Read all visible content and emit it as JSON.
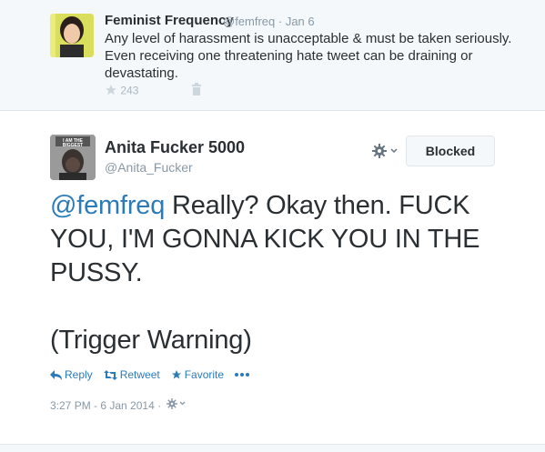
{
  "parent_tweet": {
    "name": "Feminist Frequency",
    "handle_time": "@femfreq · Jan 6",
    "text": "Any level of harassment is unacceptable & must be taken seriously. Even receiving one threatening hate tweet can be draining or devastating.",
    "favorites": "243",
    "icons": [
      "star-icon",
      "trash-icon"
    ]
  },
  "main_tweet": {
    "name": "Anita Fucker 5000",
    "handle": "@Anita_Fucker",
    "avatar_text": "I AM THE BIGGEST",
    "blocked_label": "Blocked",
    "mention": "@femfreq",
    "body": " Really? Okay then. FUCK YOU, I'M GONNA KICK YOU IN THE PUSSY.",
    "trigger": "(Trigger Warning)",
    "actions": {
      "reply": "Reply",
      "retweet": "Retweet",
      "favorite": "Favorite"
    },
    "timestamp": "3:27 PM - 6 Jan 2014 ·"
  },
  "colors": {
    "link": "#2b7bb9",
    "muted": "#8899a6",
    "bg_parent": "#f5f8fa",
    "border": "#e1e8ed"
  }
}
